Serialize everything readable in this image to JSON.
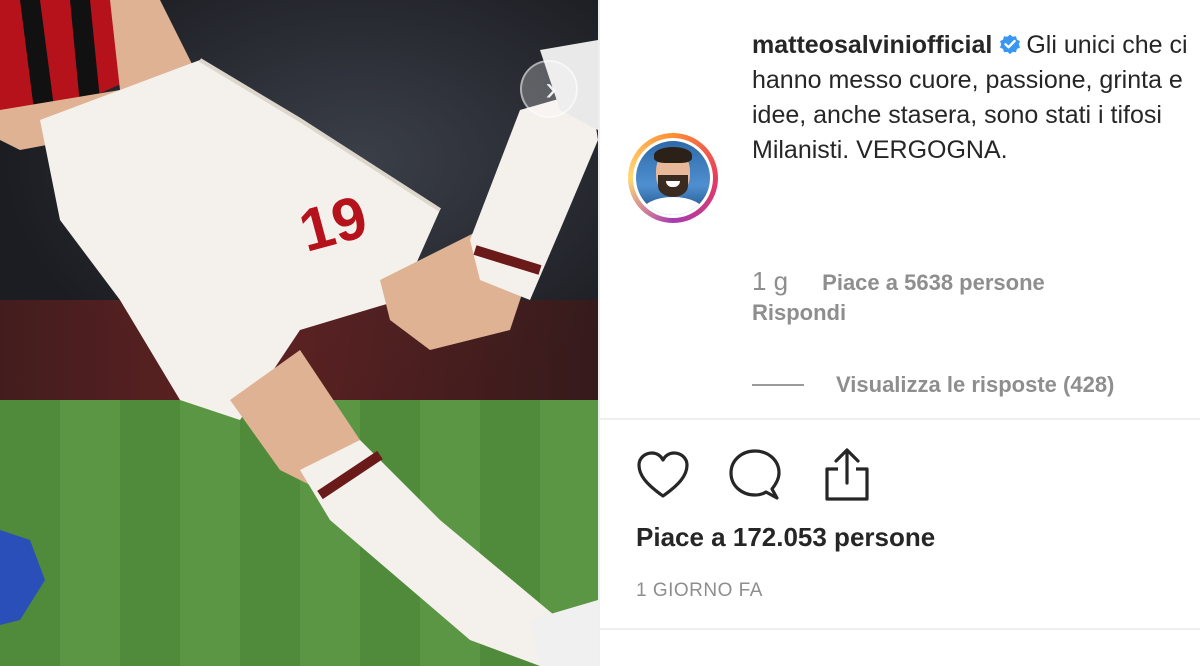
{
  "post": {
    "username": "matteosalviniofficial",
    "caption": "Gli unici che ci hanno messo cuore, passione, grinta e idee, anche stasera, sono stati i tifosi Milanisti. VERGOGNA.",
    "comment_time": "1 g",
    "comment_likes": "Piace a 5638 persone",
    "reply_label": "Rispondi",
    "view_replies": "Visualizza le risposte (428)",
    "likes": "Piace a 172.053 persone",
    "timestamp": "1 GIORNO FA"
  },
  "photo": {
    "jersey_number": "19"
  },
  "icons": {
    "verified": "verified-badge-icon",
    "like": "heart-icon",
    "comment": "comment-bubble-icon",
    "share": "share-icon",
    "next": "chevron-right-icon"
  },
  "colors": {
    "verified": "#3897f0",
    "text": "#262626",
    "muted": "#8e8e8e"
  }
}
